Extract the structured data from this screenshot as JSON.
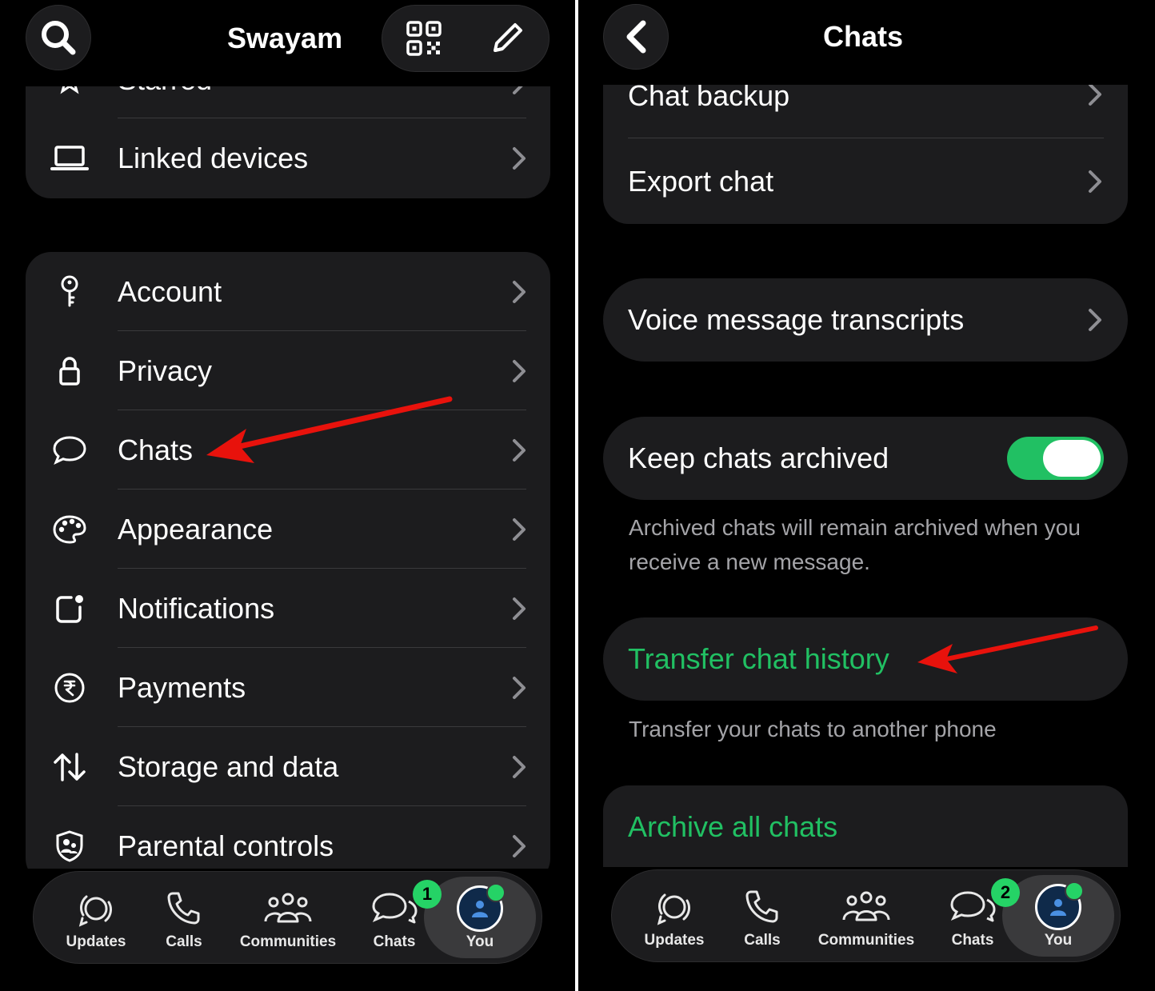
{
  "left": {
    "header": {
      "title": "Swayam"
    },
    "top_group": {
      "partial_item": "Starred",
      "items": [
        {
          "label": "Linked devices",
          "icon": "laptop-icon"
        }
      ]
    },
    "settings": [
      {
        "label": "Account",
        "icon": "key-icon"
      },
      {
        "label": "Privacy",
        "icon": "lock-icon"
      },
      {
        "label": "Chats",
        "icon": "chat-bubble-icon"
      },
      {
        "label": "Appearance",
        "icon": "palette-icon"
      },
      {
        "label": "Notifications",
        "icon": "notification-icon"
      },
      {
        "label": "Payments",
        "icon": "rupee-icon"
      },
      {
        "label": "Storage and data",
        "icon": "arrows-updown-icon"
      },
      {
        "label": "Parental controls",
        "icon": "shield-family-icon"
      }
    ],
    "tabs": [
      {
        "label": "Updates",
        "icon": "updates-icon"
      },
      {
        "label": "Calls",
        "icon": "phone-icon"
      },
      {
        "label": "Communities",
        "icon": "communities-icon"
      },
      {
        "label": "Chats",
        "icon": "chats-icon",
        "badge": "1"
      },
      {
        "label": "You",
        "icon": "avatar-icon",
        "active": true
      }
    ]
  },
  "right": {
    "header": {
      "title": "Chats"
    },
    "group1": [
      {
        "label": "Chat backup"
      },
      {
        "label": "Export chat"
      }
    ],
    "voice": {
      "label": "Voice message transcripts"
    },
    "archived": {
      "label": "Keep chats archived",
      "toggle_on": true,
      "caption": "Archived chats will remain archived when you receive a new message."
    },
    "transfer": {
      "label": "Transfer chat history",
      "caption": "Transfer your chats to another phone"
    },
    "archive_all": {
      "label": "Archive all chats"
    },
    "tabs": [
      {
        "label": "Updates",
        "icon": "updates-icon"
      },
      {
        "label": "Calls",
        "icon": "phone-icon"
      },
      {
        "label": "Communities",
        "icon": "communities-icon"
      },
      {
        "label": "Chats",
        "icon": "chats-icon",
        "badge": "2"
      },
      {
        "label": "You",
        "icon": "avatar-icon",
        "active": true
      }
    ]
  },
  "colors": {
    "accent_green": "#21c063",
    "annotation_red": "#e8120c",
    "group_bg": "#1c1c1e",
    "caption_gray": "#a4a4a8"
  }
}
